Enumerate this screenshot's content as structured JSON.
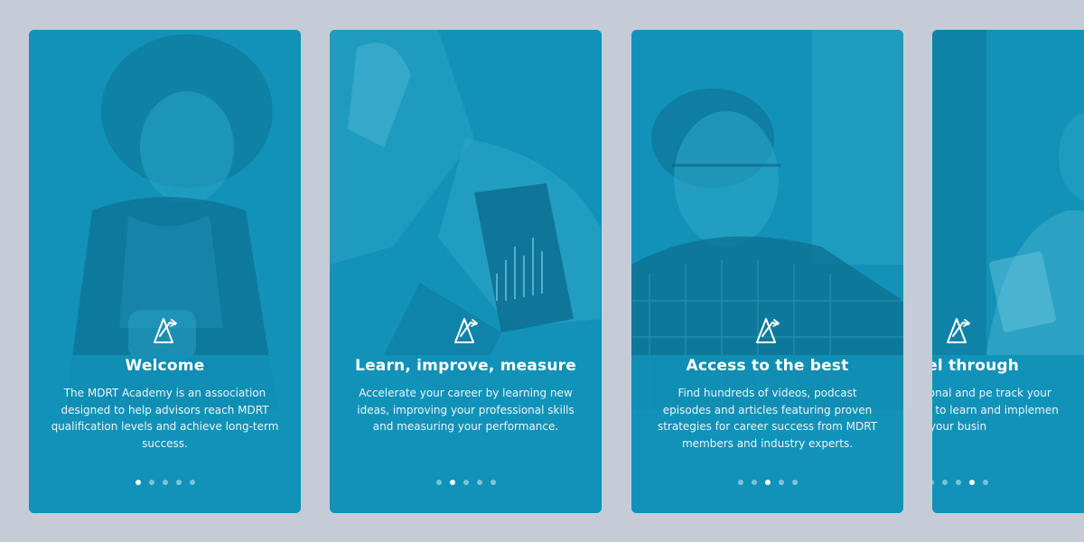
{
  "colors": {
    "page_background": "#c4ccd8",
    "card_tint": "#1292b8",
    "dot_active": "#ffffff",
    "dot_inactive": "rgba(255,255,255,0.45)"
  },
  "logo_icon": "mdrt-academy-logo-icon",
  "cards": [
    {
      "title": "Welcome",
      "body": "The MDRT Academy is an association designed to help advisors reach MDRT qualification levels and achieve long-term success.",
      "active_dot": 1,
      "photo": "woman-looking-at-phone"
    },
    {
      "title": "Learn, improve, measure",
      "body": "Accelerate your career by learning new ideas, improving your professional skills and measuring your performance.",
      "active_dot": 2,
      "photo": "man-using-laptop-with-chart"
    },
    {
      "title": "Access to the best",
      "body": "Find hundreds of videos, podcast episodes and articles featuring proven strategies for career success from MDRT members and industry experts.",
      "active_dot": 3,
      "photo": "man-with-glasses-talking"
    },
    {
      "title": "Excel through",
      "body": "Set professional and pe track your progress over to learn and implemen your busin",
      "active_dot": 4,
      "photo": "woman-in-white-coat"
    }
  ],
  "dot_count": 5
}
